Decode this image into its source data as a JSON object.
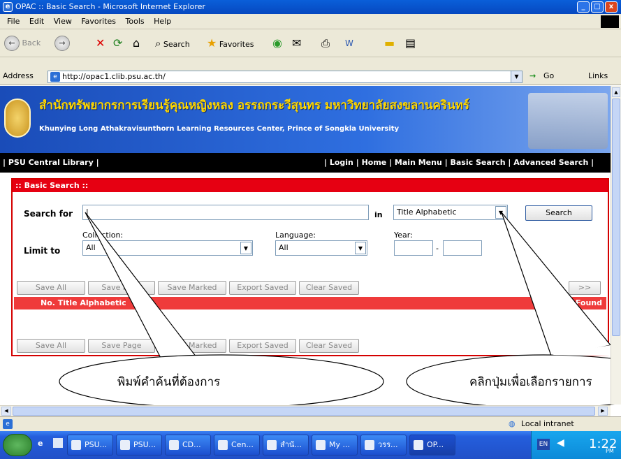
{
  "window": {
    "title": "OPAC :: Basic Search - Microsoft Internet Explorer"
  },
  "menu": [
    "File",
    "Edit",
    "View",
    "Favorites",
    "Tools",
    "Help"
  ],
  "toolbar": {
    "back": "Back",
    "search": "Search",
    "favorites": "Favorites"
  },
  "address": {
    "label": "Address",
    "url": "http://opac1.clib.psu.ac.th/",
    "go": "Go",
    "links": "Links"
  },
  "banner": {
    "thai": "สำนักทรัพยากรการเรียนรู้คุณหญิงหลง อรรถกระวีสุนทร มหาวิทยาลัยสงขลานครินทร์",
    "english": "Khunying Long Athakravisunthorn Learning Resources Center, Prince of Songkla University"
  },
  "nav": {
    "left": "| PSU Central Library |",
    "right": "| Login | Home | Main Menu | Basic Search | Advanced Search |"
  },
  "search": {
    "header": ":: Basic Search ::",
    "search_for": "Search for",
    "in": "in",
    "field_value": "Title Alphabetic",
    "search_button": "Search",
    "limit_to": "Limit to",
    "collection_label": "Collection:",
    "collection_value": "All",
    "language_label": "Language:",
    "language_value": "All",
    "year_label": "Year:",
    "year_sep": "-"
  },
  "buttons_top": [
    "Save All",
    "Save Page",
    "Save Marked",
    "Export Saved",
    "Clear Saved"
  ],
  "buttons_bottom": [
    "Save All",
    "Save Page",
    "Save Marked",
    "Export Saved",
    "Clear Saved"
  ],
  "pager": {
    "next": ">>"
  },
  "results": {
    "header": "No.  Title Alphabetic",
    "found": "Found"
  },
  "callouts": {
    "left": "พิมพ์คำค้นที่ต้องการ",
    "right": "คลิกปุ่มเพื่อเลือกรายการ"
  },
  "status": {
    "zone": "Local intranet"
  },
  "taskbar": {
    "items": [
      "PSU...",
      "PSU...",
      "CD...",
      "Cen...",
      "สำนั...",
      "My ...",
      "วรร...",
      "OP..."
    ],
    "lang": "EN",
    "time": "1:22",
    "ampm": "PM"
  }
}
